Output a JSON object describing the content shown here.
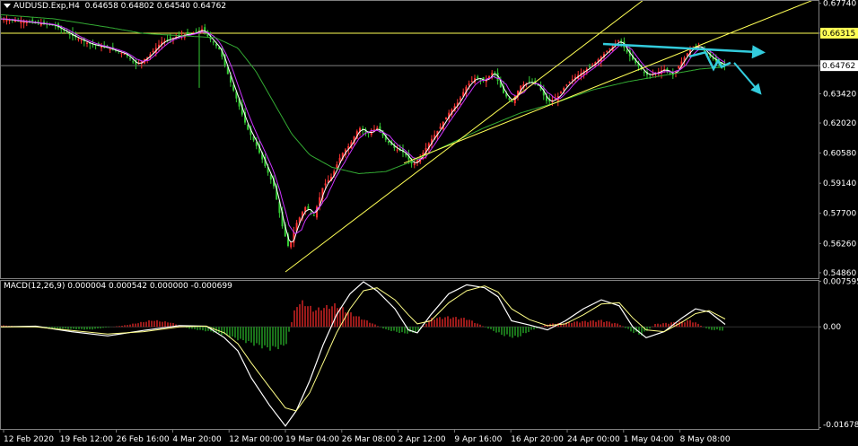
{
  "symbol_bar": {
    "symbol": "AUDUSD.Exp,H4",
    "ohlc": "0.64658 0.64802 0.64540 0.64762"
  },
  "macd_label": "MACD(12,26,9) 0.000004 0.000542 0.000000 -0.000699",
  "colors": {
    "background": "#000000",
    "grid": "#7f7f7f",
    "bull_candle": "#ff3333",
    "bear_candle": "#33cc33",
    "ma_fast": "#ffffff",
    "ma_mid": "#cc33ff",
    "ma_slow": "#33aa33",
    "trend_line": "#ffff55",
    "annotation": "#33ccdd",
    "macd_hist_pos": "#cc2222",
    "macd_hist_neg": "#229922"
  },
  "chart_data": [
    {
      "type": "candlestick",
      "title": "AUDUSD.Exp,H4",
      "y_axis": {
        "ticks": [
          "0.67740",
          "0.66315",
          "0.64762",
          "0.63420",
          "0.62020",
          "0.60580",
          "0.59140",
          "0.57700",
          "0.56260",
          "0.54860"
        ],
        "ylim": [
          0.546,
          0.679
        ]
      },
      "x_axis": {
        "ticks": [
          "12 Feb 2020",
          "19 Feb 12:00",
          "26 Feb 16:00",
          "4 Mar 20:00",
          "12 Mar 00:00",
          "19 Mar 04:00",
          "26 Mar 08:00",
          "2 Apr 12:00",
          "9 Apr 16:00",
          "16 Apr 20:00",
          "24 Apr 00:00",
          "1 May 04:00",
          "8 May 08:00"
        ]
      },
      "horizontal_levels": [
        {
          "value": 0.66315,
          "label": "0.66315",
          "color": "#ffff55"
        },
        {
          "value": 0.64762,
          "label": "0.64762",
          "color": "#7f7f7f"
        }
      ],
      "price_path": [
        [
          0,
          0.67
        ],
        [
          20,
          0.669
        ],
        [
          40,
          0.668
        ],
        [
          60,
          0.667
        ],
        [
          80,
          0.662
        ],
        [
          100,
          0.658
        ],
        [
          120,
          0.656
        ],
        [
          140,
          0.653
        ],
        [
          152,
          0.648
        ],
        [
          165,
          0.652
        ],
        [
          180,
          0.659
        ],
        [
          200,
          0.662
        ],
        [
          215,
          0.663
        ],
        [
          225,
          0.665
        ],
        [
          235,
          0.66
        ],
        [
          245,
          0.655
        ],
        [
          255,
          0.642
        ],
        [
          265,
          0.63
        ],
        [
          275,
          0.618
        ],
        [
          285,
          0.61
        ],
        [
          295,
          0.6
        ],
        [
          305,
          0.59
        ],
        [
          315,
          0.57
        ],
        [
          322,
          0.56
        ],
        [
          330,
          0.572
        ],
        [
          340,
          0.58
        ],
        [
          350,
          0.576
        ],
        [
          360,
          0.59
        ],
        [
          370,
          0.595
        ],
        [
          380,
          0.605
        ],
        [
          390,
          0.61
        ],
        [
          400,
          0.618
        ],
        [
          410,
          0.615
        ],
        [
          420,
          0.618
        ],
        [
          430,
          0.612
        ],
        [
          440,
          0.608
        ],
        [
          450,
          0.606
        ],
        [
          460,
          0.6
        ],
        [
          470,
          0.605
        ],
        [
          480,
          0.612
        ],
        [
          490,
          0.618
        ],
        [
          500,
          0.625
        ],
        [
          510,
          0.63
        ],
        [
          520,
          0.638
        ],
        [
          530,
          0.642
        ],
        [
          540,
          0.64
        ],
        [
          550,
          0.645
        ],
        [
          560,
          0.635
        ],
        [
          570,
          0.63
        ],
        [
          580,
          0.638
        ],
        [
          590,
          0.64
        ],
        [
          600,
          0.638
        ],
        [
          610,
          0.63
        ],
        [
          620,
          0.632
        ],
        [
          630,
          0.638
        ],
        [
          640,
          0.642
        ],
        [
          650,
          0.645
        ],
        [
          660,
          0.648
        ],
        [
          670,
          0.652
        ],
        [
          680,
          0.656
        ],
        [
          690,
          0.66
        ],
        [
          700,
          0.653
        ],
        [
          710,
          0.648
        ],
        [
          720,
          0.643
        ],
        [
          730,
          0.644
        ],
        [
          740,
          0.646
        ],
        [
          750,
          0.643
        ],
        [
          760,
          0.65
        ],
        [
          770,
          0.656
        ],
        [
          780,
          0.657
        ],
        [
          790,
          0.652
        ],
        [
          800,
          0.649
        ],
        [
          808,
          0.6476
        ]
      ],
      "moving_averages": {
        "slow_path": [
          [
            0,
            0.672
          ],
          [
            60,
            0.67
          ],
          [
            120,
            0.666
          ],
          [
            160,
            0.663
          ],
          [
            200,
            0.662
          ],
          [
            240,
            0.661
          ],
          [
            265,
            0.656
          ],
          [
            285,
            0.645
          ],
          [
            305,
            0.63
          ],
          [
            325,
            0.615
          ],
          [
            345,
            0.605
          ],
          [
            370,
            0.599
          ],
          [
            400,
            0.596
          ],
          [
            430,
            0.597
          ],
          [
            460,
            0.602
          ],
          [
            500,
            0.61
          ],
          [
            540,
            0.618
          ],
          [
            580,
            0.625
          ],
          [
            620,
            0.63
          ],
          [
            660,
            0.636
          ],
          [
            700,
            0.64
          ],
          [
            740,
            0.643
          ],
          [
            780,
            0.646
          ],
          [
            808,
            0.647
          ]
        ]
      },
      "trend_lines": [
        {
          "from": [
            318,
            0.549
          ],
          "to": [
            720,
            0.68
          ]
        },
        {
          "from": [
            450,
            0.601
          ],
          "to": [
            912,
            0.68
          ]
        }
      ],
      "annotations": {
        "upper_arrow": {
          "from": [
            672,
            0.658
          ],
          "to": [
            848,
            0.654
          ]
        },
        "zigzag": [
          [
            768,
            0.652
          ],
          [
            786,
            0.654
          ],
          [
            795,
            0.646
          ],
          [
            800,
            0.65
          ],
          [
            804,
            0.647
          ],
          [
            814,
            0.649
          ]
        ],
        "down_arrow": {
          "from": [
            818,
            0.649
          ],
          "to": [
            846,
            0.635
          ]
        }
      }
    },
    {
      "type": "macd",
      "title": "MACD(12,26,9)",
      "y_axis": {
        "ticks": [
          "0.007595",
          "0.00",
          "-0.016785"
        ],
        "ylim": [
          -0.017,
          0.0078
        ]
      },
      "macd_line": [
        [
          0,
          0.0
        ],
        [
          40,
          0.0001
        ],
        [
          80,
          -0.0008
        ],
        [
          120,
          -0.0015
        ],
        [
          160,
          -0.0006
        ],
        [
          200,
          0.0002
        ],
        [
          230,
          0.0001
        ],
        [
          250,
          -0.0018
        ],
        [
          265,
          -0.004
        ],
        [
          280,
          -0.0085
        ],
        [
          300,
          -0.013
        ],
        [
          318,
          -0.0165
        ],
        [
          330,
          -0.014
        ],
        [
          345,
          -0.009
        ],
        [
          360,
          -0.003
        ],
        [
          375,
          0.002
        ],
        [
          390,
          0.0055
        ],
        [
          405,
          0.0075
        ],
        [
          420,
          0.006
        ],
        [
          440,
          0.003
        ],
        [
          455,
          -0.0005
        ],
        [
          465,
          -0.001
        ],
        [
          480,
          0.002
        ],
        [
          500,
          0.0055
        ],
        [
          520,
          0.007
        ],
        [
          540,
          0.0065
        ],
        [
          555,
          0.005
        ],
        [
          570,
          0.001
        ],
        [
          590,
          0.0003
        ],
        [
          610,
          -0.0005
        ],
        [
          630,
          0.001
        ],
        [
          650,
          0.003
        ],
        [
          670,
          0.0045
        ],
        [
          690,
          0.0035
        ],
        [
          705,
          0.0
        ],
        [
          720,
          -0.0018
        ],
        [
          740,
          -0.0008
        ],
        [
          760,
          0.0015
        ],
        [
          775,
          0.003
        ],
        [
          790,
          0.0025
        ],
        [
          808,
          0.0004
        ]
      ],
      "signal_line": [
        [
          0,
          0.0
        ],
        [
          40,
          0.0
        ],
        [
          80,
          -0.0006
        ],
        [
          120,
          -0.0012
        ],
        [
          160,
          -0.0008
        ],
        [
          200,
          0.0
        ],
        [
          230,
          0.0001
        ],
        [
          250,
          -0.001
        ],
        [
          265,
          -0.0028
        ],
        [
          280,
          -0.006
        ],
        [
          300,
          -0.01
        ],
        [
          318,
          -0.0135
        ],
        [
          330,
          -0.014
        ],
        [
          345,
          -0.011
        ],
        [
          360,
          -0.006
        ],
        [
          375,
          -0.001
        ],
        [
          390,
          0.003
        ],
        [
          405,
          0.006
        ],
        [
          420,
          0.0065
        ],
        [
          440,
          0.0045
        ],
        [
          455,
          0.002
        ],
        [
          465,
          0.0005
        ],
        [
          480,
          0.001
        ],
        [
          500,
          0.004
        ],
        [
          520,
          0.006
        ],
        [
          540,
          0.0068
        ],
        [
          555,
          0.0058
        ],
        [
          570,
          0.003
        ],
        [
          590,
          0.0012
        ],
        [
          610,
          0.0002
        ],
        [
          630,
          0.0005
        ],
        [
          650,
          0.002
        ],
        [
          670,
          0.0038
        ],
        [
          690,
          0.004
        ],
        [
          705,
          0.0015
        ],
        [
          720,
          -0.0005
        ],
        [
          740,
          -0.0008
        ],
        [
          760,
          0.0008
        ],
        [
          775,
          0.0022
        ],
        [
          790,
          0.0027
        ],
        [
          808,
          0.0013
        ]
      ],
      "histogram_path": [
        [
          0,
          0.0003
        ],
        [
          60,
          -0.0003
        ],
        [
          100,
          -0.0005
        ],
        [
          140,
          0.0003
        ],
        [
          170,
          0.0012
        ],
        [
          190,
          0.0008
        ],
        [
          210,
          -0.0003
        ],
        [
          240,
          -0.001
        ],
        [
          260,
          -0.002
        ],
        [
          280,
          -0.003
        ],
        [
          300,
          -0.004
        ],
        [
          318,
          -0.0035
        ],
        [
          330,
          0.004
        ],
        [
          338,
          0.0045
        ],
        [
          350,
          0.003
        ],
        [
          360,
          0.0035
        ],
        [
          375,
          0.004
        ],
        [
          390,
          0.0025
        ],
        [
          410,
          0.001
        ],
        [
          430,
          -0.0005
        ],
        [
          450,
          -0.0012
        ],
        [
          465,
          -0.001
        ],
        [
          480,
          0.0015
        ],
        [
          500,
          0.0018
        ],
        [
          520,
          0.0015
        ],
        [
          540,
          0.0
        ],
        [
          560,
          -0.0015
        ],
        [
          575,
          -0.002
        ],
        [
          590,
          -0.0008
        ],
        [
          610,
          0.0005
        ],
        [
          630,
          0.0008
        ],
        [
          650,
          0.001
        ],
        [
          670,
          0.0012
        ],
        [
          690,
          0.0005
        ],
        [
          705,
          -0.001
        ],
        [
          715,
          -0.0015
        ],
        [
          730,
          0.0005
        ],
        [
          750,
          0.0008
        ],
        [
          770,
          0.0012
        ],
        [
          790,
          -0.0005
        ],
        [
          808,
          -0.0007
        ]
      ]
    }
  ]
}
